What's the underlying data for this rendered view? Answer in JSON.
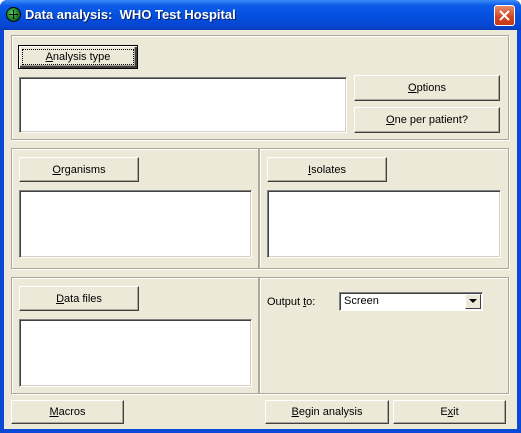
{
  "window": {
    "title": "Data analysis:  WHO Test Hospital"
  },
  "analysis": {
    "type_button": {
      "pre": "",
      "key": "A",
      "post": "nalysis type"
    },
    "options_button": {
      "pre": "",
      "key": "O",
      "post": "ptions"
    },
    "one_per_patient_button": {
      "pre": "",
      "key": "O",
      "post": "ne per patient?"
    }
  },
  "organisms": {
    "button": {
      "pre": "",
      "key": "O",
      "post": "rganisms"
    }
  },
  "isolates": {
    "button": {
      "pre": "",
      "key": "I",
      "post": "solates"
    }
  },
  "data_files": {
    "button": {
      "pre": "",
      "key": "D",
      "post": "ata files"
    }
  },
  "output": {
    "label": {
      "pre": "Output ",
      "key": "t",
      "post": "o:"
    },
    "selected": "Screen"
  },
  "footer": {
    "macros_button": {
      "pre": "",
      "key": "M",
      "post": "acros"
    },
    "begin_button": {
      "pre": "",
      "key": "B",
      "post": "egin analysis"
    },
    "exit_button": {
      "pre": "E",
      "key": "x",
      "post": "it"
    }
  },
  "colors": {
    "title_bar": "#0550e0",
    "face": "#ece9d8",
    "close": "#d1431d"
  },
  "icons": {
    "app": "globe-icon",
    "close": "close-icon",
    "dropdown": "chevron-down-icon"
  }
}
